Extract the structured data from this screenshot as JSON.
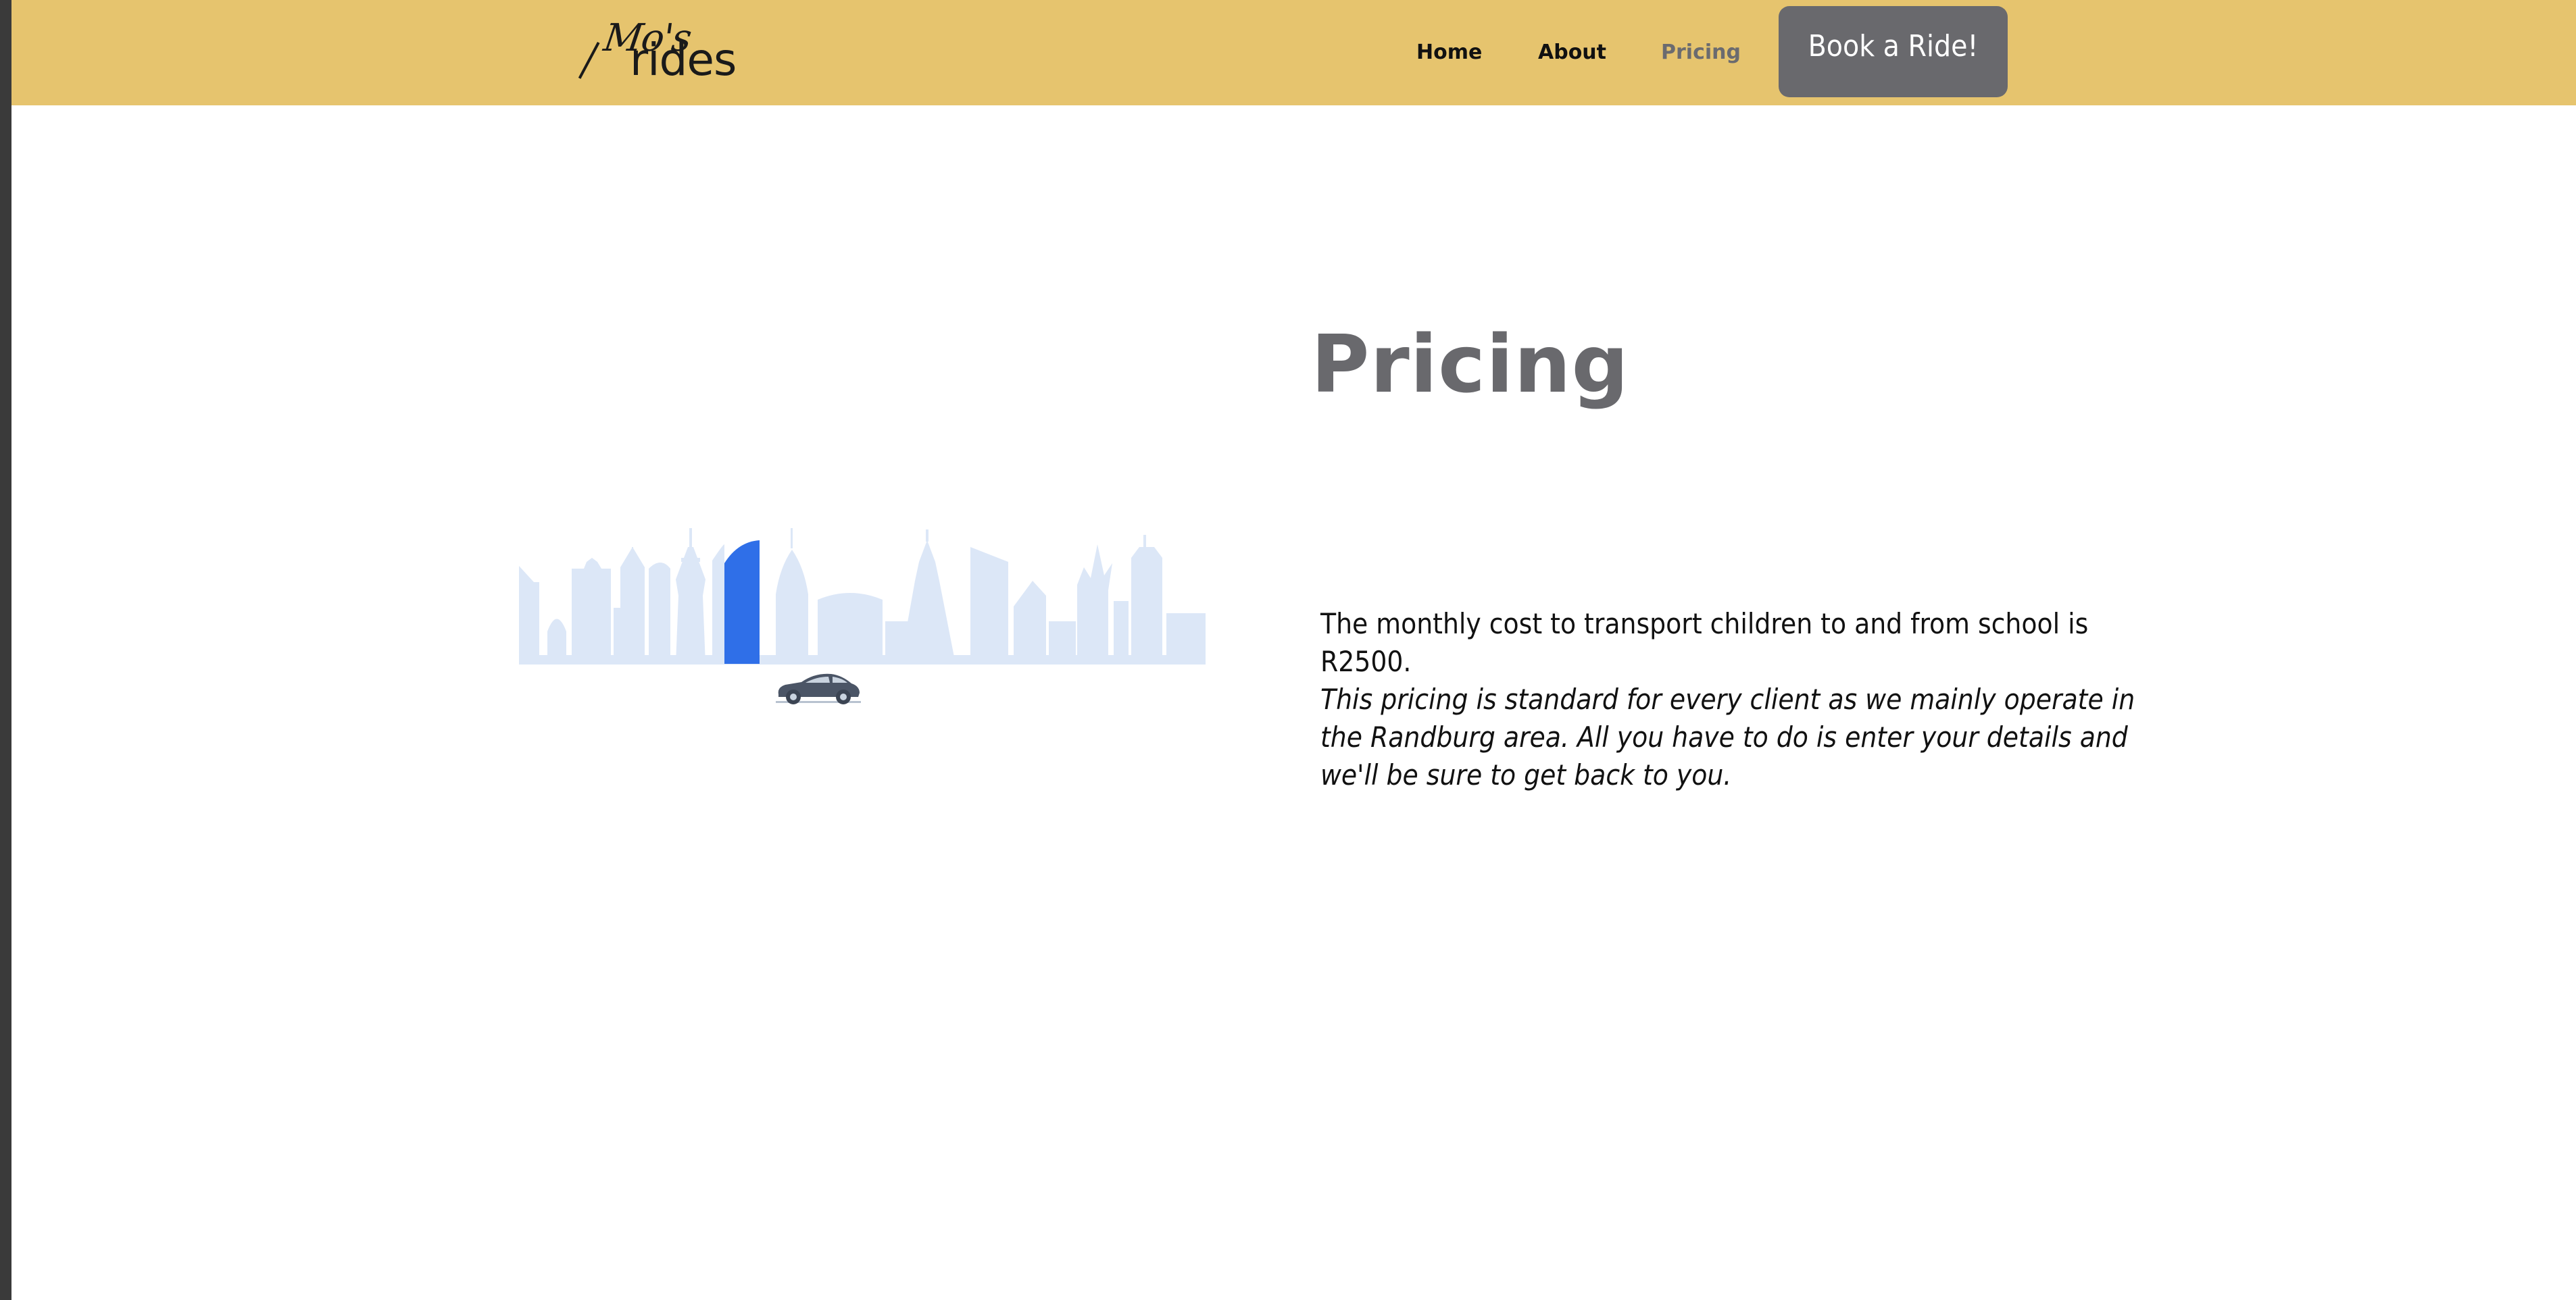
{
  "header": {
    "logo": {
      "line1": "Mo's",
      "line2": "rides"
    },
    "nav": {
      "home": "Home",
      "about": "About",
      "pricing": "Pricing"
    },
    "cta_label": "Book a Ride!"
  },
  "main": {
    "title": "Pricing",
    "cost_text": "The monthly cost to transport children to and from school is R2500.",
    "note_text": "This pricing is standard for every client as we mainly operate in the Randburg area. All you have to do is enter your details and we'll be sure to get back to you."
  },
  "colors": {
    "nav_background": "#e6c46e",
    "button_background": "#69696d",
    "skyline": "#dce7f7",
    "skyline_accent": "#2f6fe8",
    "car": "#4b5566"
  },
  "icons": {
    "illustration": "city-skyline-illustration",
    "car": "car-icon"
  }
}
